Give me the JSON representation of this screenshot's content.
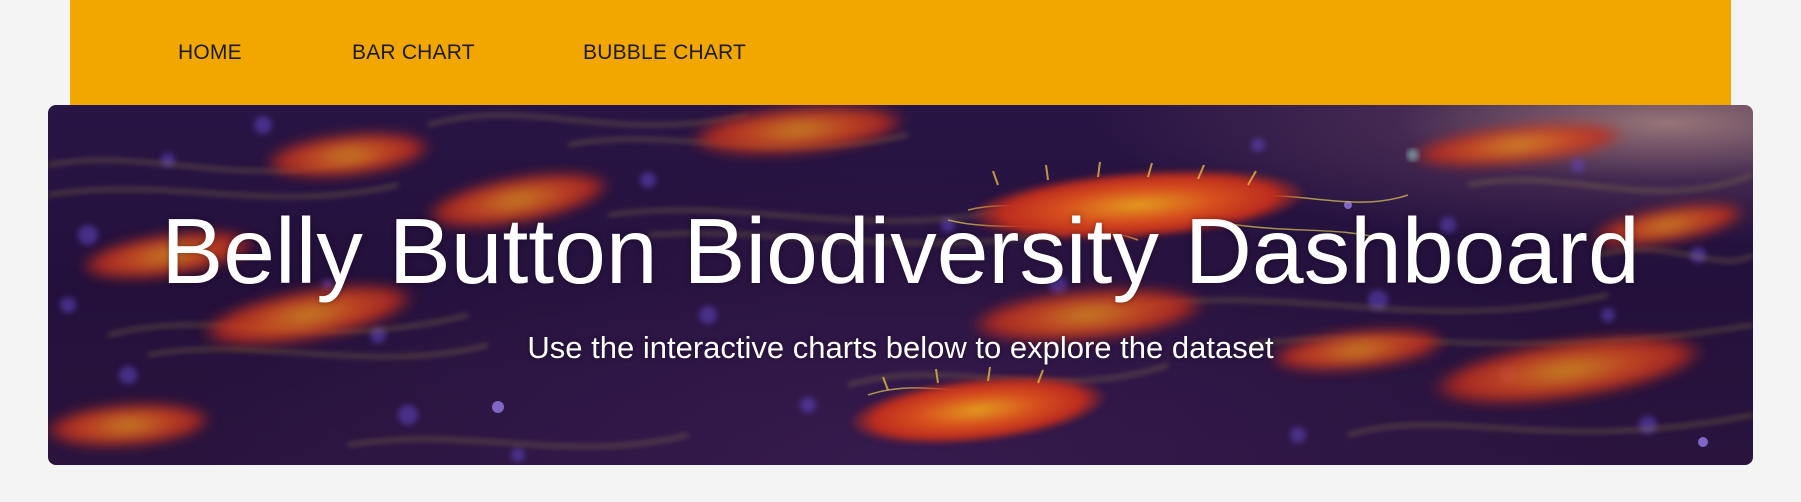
{
  "nav": {
    "items": [
      {
        "label": "HOME"
      },
      {
        "label": "BAR CHART"
      },
      {
        "label": "BUBBLE CHART"
      }
    ],
    "background_color": "#f2a700",
    "text_color": "#1b1b1b"
  },
  "hero": {
    "title": "Belly Button Biodiversity Dashboard",
    "subtitle": "Use the interactive charts below to explore the dataset",
    "background_image": "bacteria-illustration",
    "text_color": "#ffffff"
  },
  "page": {
    "background_color": "#f4f4f4"
  }
}
